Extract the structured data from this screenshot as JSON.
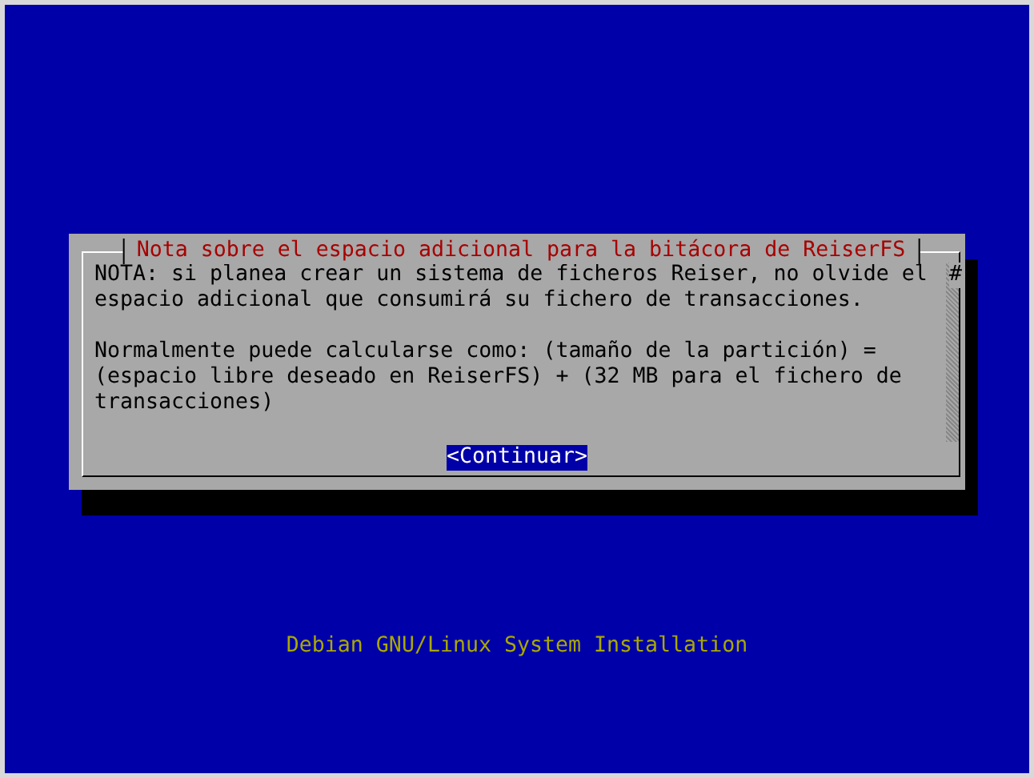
{
  "dialog": {
    "title": "Nota sobre el espacio adicional para la bitácora de ReiserFS",
    "paragraphs": [
      [
        "NOTA: si planea crear un sistema de ficheros Reiser, no olvide el",
        "espacio adicional que consumirá su fichero de transacciones."
      ],
      [
        "Normalmente puede calcularse como: (tamaño de la partición) =",
        "(espacio libre deseado en ReiserFS) + (32 MB para el fichero de",
        "transacciones)"
      ]
    ],
    "scroll_marker": "#",
    "buttons": [
      {
        "label": "<Continuar>",
        "selected": true
      }
    ]
  },
  "footer": "Debian GNU/Linux System Installation"
}
